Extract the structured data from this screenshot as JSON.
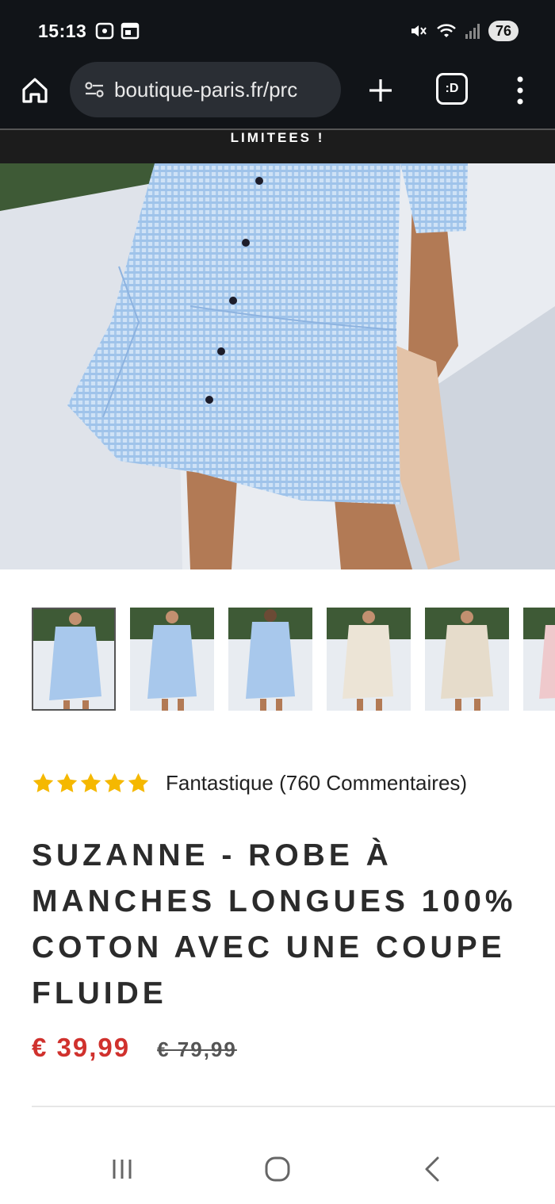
{
  "status_bar": {
    "time": "15:13",
    "battery": "76",
    "icons_left": [
      "screenshot-icon",
      "window-icon"
    ],
    "icons_right": [
      "mute-icon",
      "wifi-icon",
      "signal-icon"
    ]
  },
  "browser": {
    "url": "boutique-paris.fr/prc",
    "tabs_label": ":D"
  },
  "announcement": {
    "text": "LIMITEES !"
  },
  "product": {
    "rating_label": "Fantastique (760 Commentaires)",
    "rating_stars": 5,
    "title": "SUZANNE - ROBE À MANCHES LONGUES 100% COTON AVEC UNE COUPE FLUIDE",
    "price_current": "€ 39,99",
    "price_old": "€ 79,99",
    "thumbnail_count": 6,
    "selected_thumbnail": 1
  },
  "colors": {
    "accent_price": "#d0312d",
    "star": "#f5b800",
    "status_bar_bg": "#111418"
  },
  "nav": {
    "icons": [
      "recents-icon",
      "home-circle-icon",
      "back-icon"
    ]
  }
}
